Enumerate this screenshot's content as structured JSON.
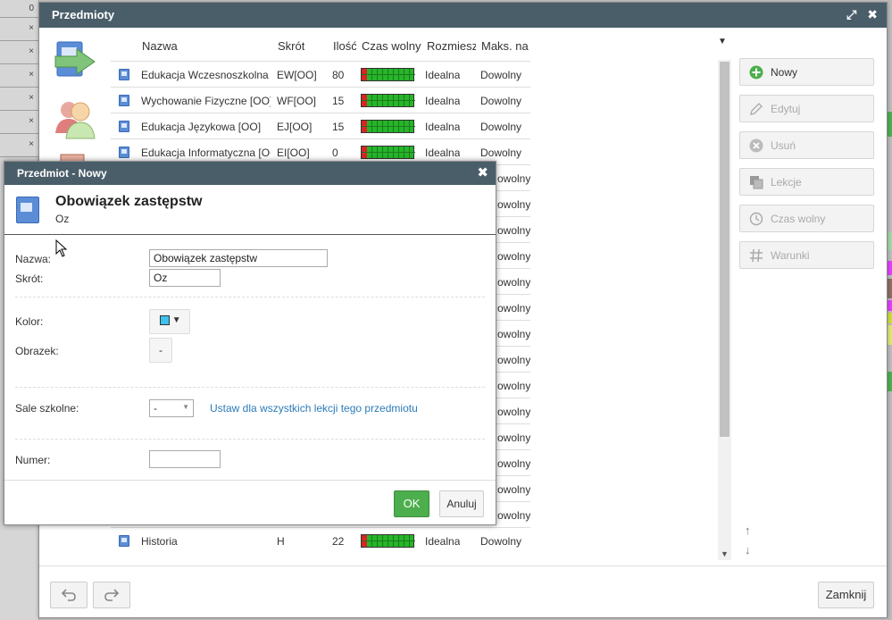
{
  "window": {
    "title": "Przedmioty",
    "controls": {
      "maximize": "⤢",
      "close": "✖"
    }
  },
  "grid": {
    "headers": [
      "Nazwa",
      "Skrót",
      "Ilość",
      "Czas wolny",
      "Rozmieszczenie",
      "Maks. na"
    ],
    "rows": [
      {
        "name": "Edukacja Wczesnoszkolna",
        "short": "EW[OO]",
        "count": "80",
        "placement": "Idealna",
        "max": "Dowolny"
      },
      {
        "name": "Wychowanie Fizyczne [OO]",
        "short": "WF[OO]",
        "count": "15",
        "placement": "Idealna",
        "max": "Dowolny"
      },
      {
        "name": "Edukacja Językowa [OO]",
        "short": "EJ[OO]",
        "count": "15",
        "placement": "Idealna",
        "max": "Dowolny"
      },
      {
        "name": "Edukacja Informatyczna [OO]",
        "short": "EI[OO]",
        "count": "0",
        "placement": "Idealna",
        "max": "Dowolny"
      }
    ],
    "partial_rows_max": [
      "owolny",
      "owolny",
      "owolny",
      "owolny",
      "owolny",
      "owolny",
      "owolny",
      "owolny",
      "owolny",
      "owolny",
      "owolny",
      "owolny",
      "owolny",
      "owolny"
    ],
    "last_row": {
      "name": "Historia",
      "short": "H",
      "count": "22",
      "placement": "Idealna",
      "max": "Dowolny"
    }
  },
  "actions": {
    "new": "Nowy",
    "edit": "Edytuj",
    "delete": "Usuń",
    "lessons": "Lekcje",
    "free_time": "Czas wolny",
    "conditions": "Warunki"
  },
  "footer": {
    "undo_icon": "undo-icon",
    "redo_icon": "redo-icon",
    "close": "Zamknij"
  },
  "dialog": {
    "title": "Przedmiot - Nowy",
    "close": "✖",
    "heading": "Obowiązek zastępstw",
    "subheading": "Oz",
    "labels": {
      "name": "Nazwa:",
      "short": "Skrót:",
      "color": "Kolor:",
      "image": "Obrazek:",
      "rooms": "Sale szkolne:",
      "number": "Numer:"
    },
    "values": {
      "name": "Obowiązek zastępstw",
      "short": "Oz",
      "image": "-",
      "rooms": "-",
      "number": ""
    },
    "color_hex": "#3bc2ee",
    "rooms_link": "Ustaw dla wszystkich lekcji tego przedmiotu",
    "ok": "OK",
    "cancel": "Anuluj"
  },
  "background_rows": [
    "0",
    "×",
    "×",
    "×",
    "×",
    "×",
    "×"
  ]
}
